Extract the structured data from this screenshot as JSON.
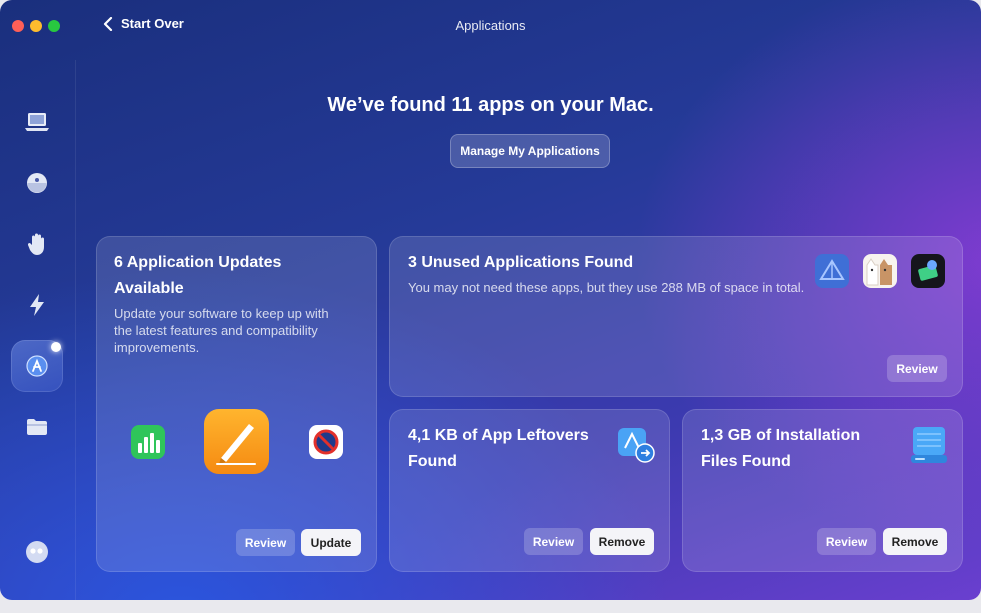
{
  "window": {
    "title": "Applications"
  },
  "nav": {
    "back_label": "Start Over"
  },
  "sidebar": {
    "items": [
      {
        "name": "smart-care",
        "icon": "laptop-icon"
      },
      {
        "name": "cleanup",
        "icon": "disk-icon"
      },
      {
        "name": "protection",
        "icon": "hand-icon"
      },
      {
        "name": "performance",
        "icon": "bolt-icon"
      },
      {
        "name": "applications",
        "icon": "app-store-icon",
        "active": true
      },
      {
        "name": "my-clutter",
        "icon": "folder-icon"
      },
      {
        "name": "assistant",
        "icon": "assistant-icon"
      }
    ]
  },
  "main": {
    "headline": "We’ve found 11 apps on your Mac.",
    "manage_button": "Manage My Applications"
  },
  "cards": {
    "updates": {
      "title": "6 Application Updates Available",
      "description": "Update your software to keep up with the latest features and compatibility improvements.",
      "review_label": "Review",
      "update_label": "Update"
    },
    "unused": {
      "title": "3 Unused Applications Found",
      "description": "You may not need these apps, but they use 288 MB of space in total.",
      "review_label": "Review"
    },
    "leftovers": {
      "title": "4,1 KB of App Leftovers Found",
      "review_label": "Review",
      "remove_label": "Remove"
    },
    "installers": {
      "title": "1,3 GB of Installation Files Found",
      "review_label": "Review",
      "remove_label": "Remove"
    }
  },
  "colors": {
    "accent": "#3d4fc4",
    "button_light": "#f4f4f8"
  }
}
